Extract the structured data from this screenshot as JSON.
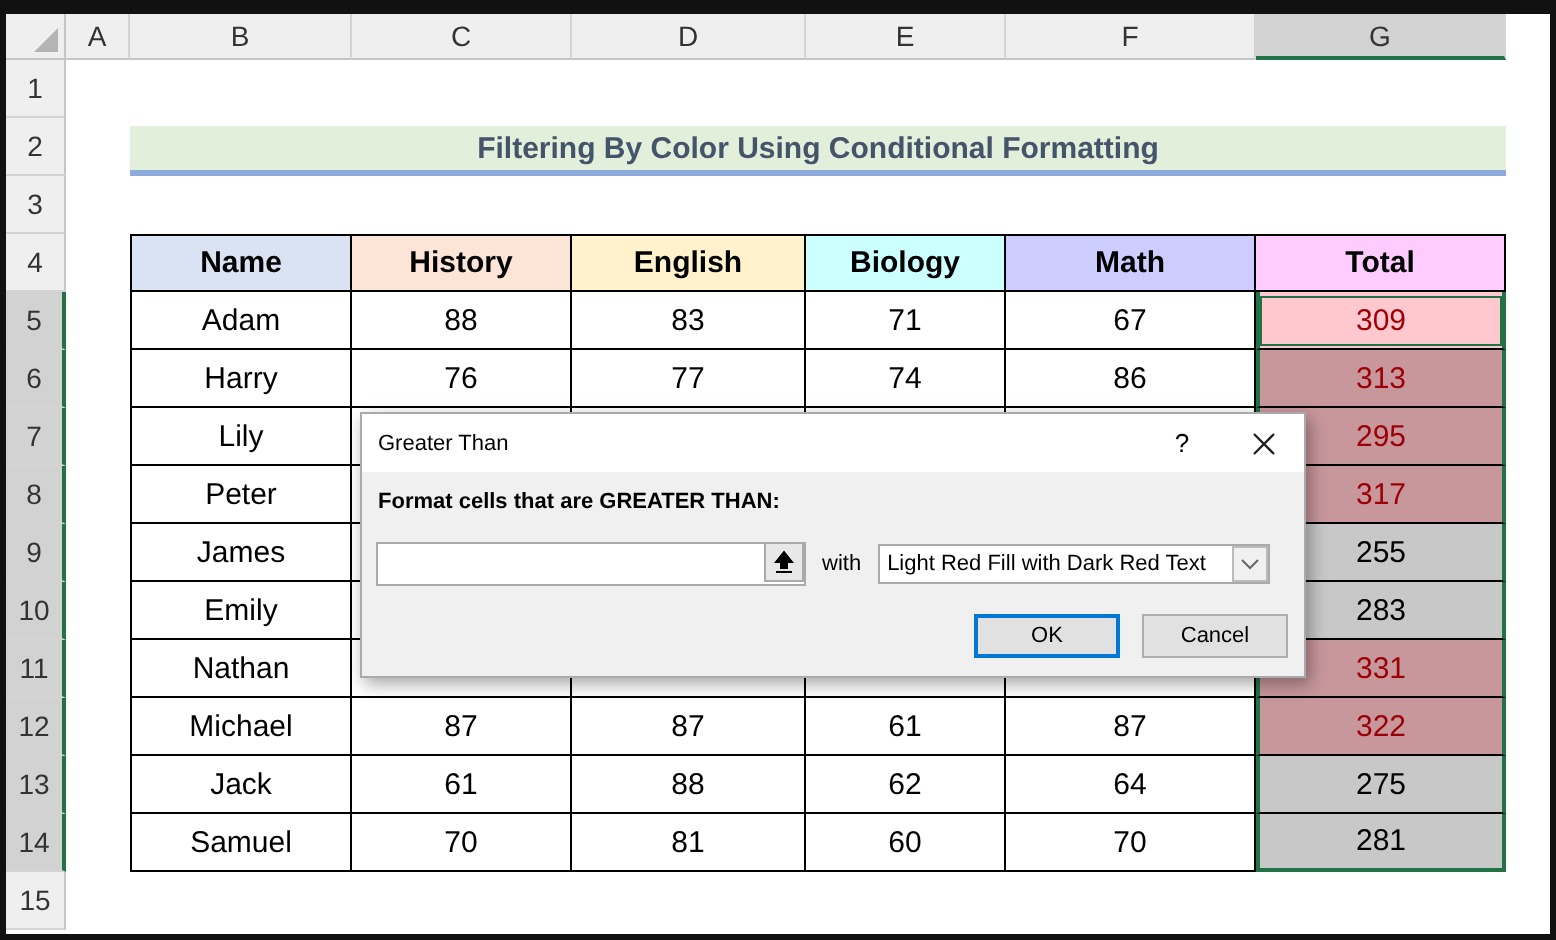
{
  "column_headers": [
    {
      "label": "A",
      "selected": false
    },
    {
      "label": "B",
      "selected": false
    },
    {
      "label": "C",
      "selected": false
    },
    {
      "label": "D",
      "selected": false
    },
    {
      "label": "E",
      "selected": false
    },
    {
      "label": "F",
      "selected": false
    },
    {
      "label": "G",
      "selected": true
    }
  ],
  "row_headers": [
    {
      "label": "1",
      "selected": false
    },
    {
      "label": "2",
      "selected": false
    },
    {
      "label": "3",
      "selected": false
    },
    {
      "label": "4",
      "selected": false
    },
    {
      "label": "5",
      "selected": true
    },
    {
      "label": "6",
      "selected": true
    },
    {
      "label": "7",
      "selected": true
    },
    {
      "label": "8",
      "selected": true
    },
    {
      "label": "9",
      "selected": true
    },
    {
      "label": "10",
      "selected": true
    },
    {
      "label": "11",
      "selected": true
    },
    {
      "label": "12",
      "selected": true
    },
    {
      "label": "13",
      "selected": true
    },
    {
      "label": "14",
      "selected": true
    },
    {
      "label": "15",
      "selected": false
    }
  ],
  "title": "Filtering By Color Using Conditional Formatting",
  "table": {
    "columns": [
      {
        "label": "Name",
        "color": "#dae3f3"
      },
      {
        "label": "History",
        "color": "#fce4d6"
      },
      {
        "label": "English",
        "color": "#fff2cc"
      },
      {
        "label": "Biology",
        "color": "#ccffff"
      },
      {
        "label": "Math",
        "color": "#ccccff"
      },
      {
        "label": "Total",
        "color": "#ffccff"
      }
    ],
    "rows": [
      {
        "name": "Adam",
        "scores": [
          "88",
          "83",
          "71",
          "67"
        ],
        "total": "309",
        "highlighted": true,
        "active": true
      },
      {
        "name": "Harry",
        "scores": [
          "76",
          "77",
          "74",
          "86"
        ],
        "total": "313",
        "highlighted": true,
        "active": false
      },
      {
        "name": "Lily",
        "scores": [],
        "total": "295",
        "highlighted": true,
        "active": false
      },
      {
        "name": "Peter",
        "scores": [],
        "total": "317",
        "highlighted": true,
        "active": false
      },
      {
        "name": "James",
        "scores": [],
        "total": "255",
        "highlighted": false,
        "active": false
      },
      {
        "name": "Emily",
        "scores": [],
        "total": "283",
        "highlighted": false,
        "active": false
      },
      {
        "name": "Nathan",
        "scores": [],
        "total": "331",
        "highlighted": true,
        "active": false
      },
      {
        "name": "Michael",
        "scores": [
          "87",
          "87",
          "61",
          "87"
        ],
        "total": "322",
        "highlighted": true,
        "active": false
      },
      {
        "name": "Jack",
        "scores": [
          "61",
          "88",
          "62",
          "64"
        ],
        "total": "275",
        "highlighted": false,
        "active": false
      },
      {
        "name": "Samuel",
        "scores": [
          "70",
          "81",
          "60",
          "70"
        ],
        "total": "281",
        "highlighted": false,
        "active": false
      }
    ]
  },
  "dialog": {
    "title": "Greater Than",
    "help": "?",
    "prompt": "Format cells that are GREATER THAN:",
    "with_label": "with",
    "format": "Light Red Fill with Dark Red Text",
    "buttons": [
      {
        "label": "OK",
        "default": true
      },
      {
        "label": "Cancel",
        "default": false
      }
    ]
  }
}
